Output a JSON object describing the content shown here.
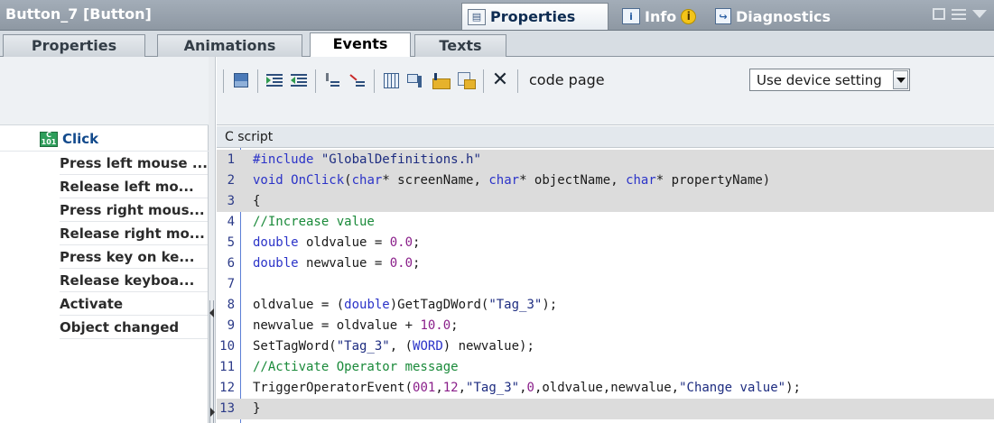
{
  "window": {
    "title": "Button_7 [Button]",
    "tabs": [
      {
        "label": "Properties",
        "icon": "properties-icon",
        "active": true
      },
      {
        "label": "Info",
        "icon": "info-icon",
        "badge": "i"
      },
      {
        "label": "Diagnostics",
        "icon": "diagnostics-icon"
      }
    ]
  },
  "subtabs": [
    {
      "label": "Properties"
    },
    {
      "label": "Animations"
    },
    {
      "label": "Events",
      "active": true
    },
    {
      "label": "Texts"
    }
  ],
  "events": {
    "selected": "Click",
    "items": [
      "Press left mouse ...",
      "Release left mo...",
      "Press right mous...",
      "Release right mo...",
      "Press key on ke...",
      "Release keyboa...",
      "Activate",
      "Object changed"
    ]
  },
  "toolbar": {
    "buttons": [
      "save-icon",
      "indent-icon",
      "outdent-icon",
      "comment-icon",
      "uncomment-icon",
      "grid-icon",
      "tag-list-icon",
      "folder-icon",
      "folder-list-icon",
      "delete-icon"
    ],
    "code_page_label": "code page",
    "code_page_value": "Use device setting"
  },
  "editor": {
    "header": "C script",
    "lines": [
      {
        "n": "1",
        "code": "#include \"GlobalDefinitions.h\"",
        "hl": true
      },
      {
        "n": "2",
        "code": "void OnClick(char* screenName, char* objectName, char* propertyName)",
        "hl": true
      },
      {
        "n": "3",
        "code": "{",
        "hl": true
      },
      {
        "n": "4",
        "code": "//Increase value",
        "hl": false
      },
      {
        "n": "5",
        "code": "double oldvalue = 0.0;",
        "hl": false
      },
      {
        "n": "6",
        "code": "double newvalue = 0.0;",
        "hl": false
      },
      {
        "n": "7",
        "code": "",
        "hl": false
      },
      {
        "n": "8",
        "code": "oldvalue = (double)GetTagDWord(\"Tag_3\");",
        "hl": false
      },
      {
        "n": "9",
        "code": "newvalue = oldvalue + 10.0;",
        "hl": false
      },
      {
        "n": "10",
        "code": "SetTagWord(\"Tag_3\", (WORD) newvalue);",
        "hl": false
      },
      {
        "n": "11",
        "code": "//Activate Operator message",
        "hl": false
      },
      {
        "n": "12",
        "code": "TriggerOperatorEvent(001,12,\"Tag_3\",0,oldvalue,newvalue,\"Change value\");",
        "hl": false
      },
      {
        "n": "13",
        "code": "}",
        "hl": true
      }
    ]
  },
  "colors": {
    "keyword": "#2b33c8",
    "string": "#1d2c80",
    "comment": "#1a8a3a",
    "highlight_line": "#dcdcdc"
  }
}
